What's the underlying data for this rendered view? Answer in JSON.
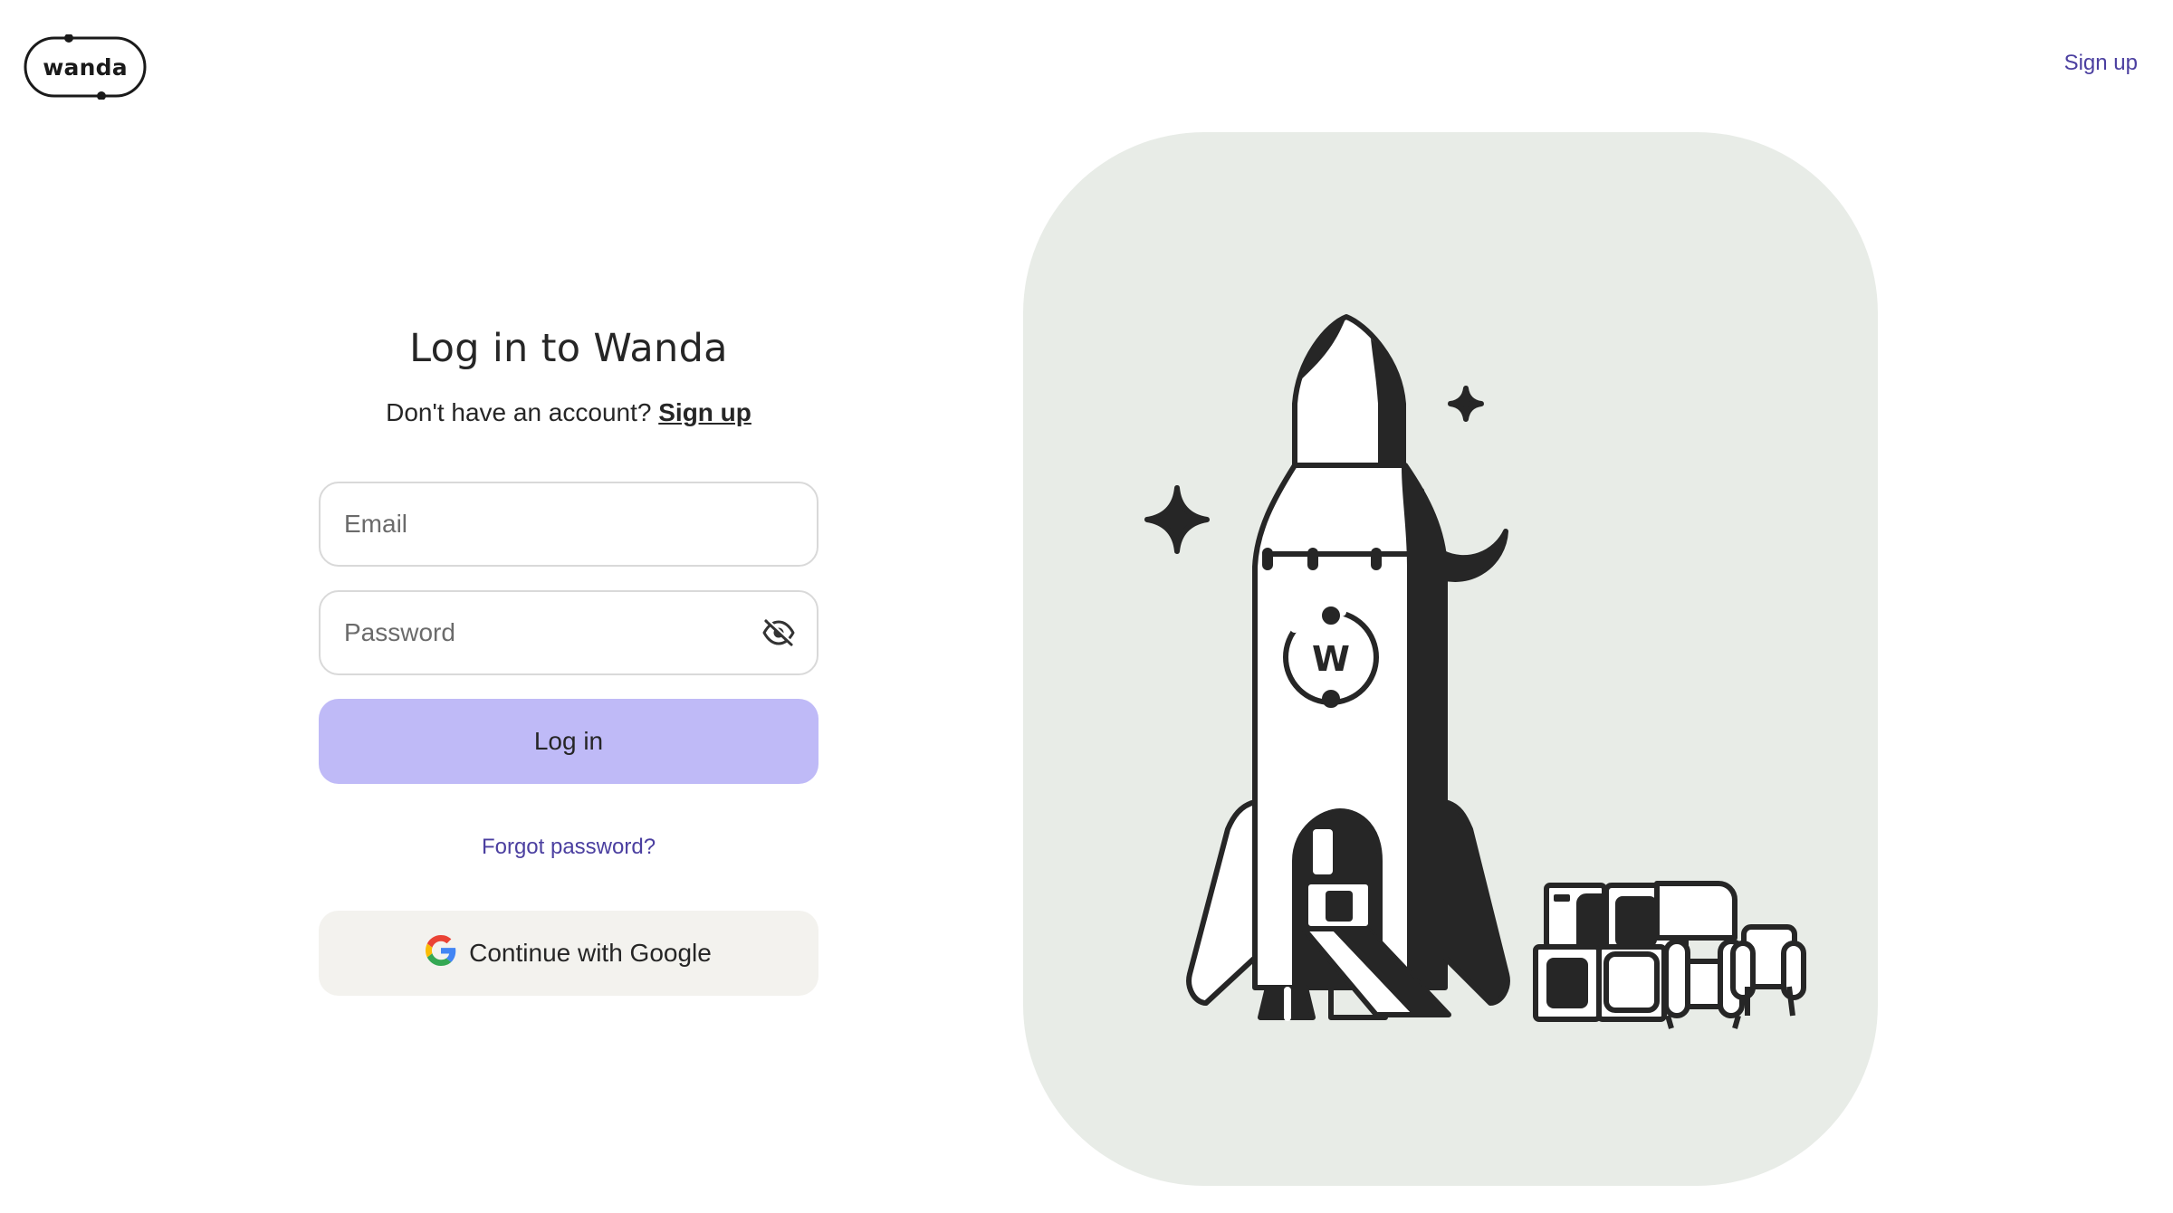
{
  "header": {
    "logo_text": "wanda",
    "signup_link": "Sign up"
  },
  "form": {
    "title": "Log in to Wanda",
    "no_account_text": "Don't have an account?",
    "signup_link": "Sign up",
    "email_placeholder": "Email",
    "password_placeholder": "Password",
    "login_button": "Log in",
    "forgot_password": "Forgot password?",
    "google_button": "Continue with Google"
  },
  "illustration": {
    "rocket_badge_letter": "W"
  },
  "colors": {
    "accent_text": "#4b3fa0",
    "login_button_bg": "#bfbaf7",
    "google_button_bg": "#f3f2ee",
    "illustration_bg": "#e8ece7"
  },
  "icons": {
    "password_toggle": "eye-off-icon",
    "google": "google-g-icon"
  }
}
